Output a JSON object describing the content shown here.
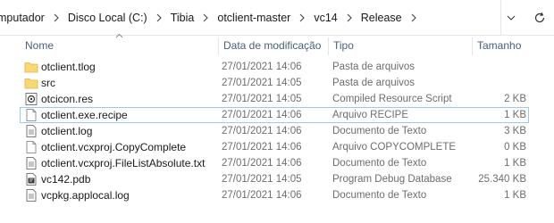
{
  "breadcrumb": [
    "mputador",
    "Disco Local (C:)",
    "Tibia",
    "otclient-master",
    "vc14",
    "Release"
  ],
  "columns": {
    "name": "Nome",
    "date": "Data de modificação",
    "type": "Tipo",
    "size": "Tamanho"
  },
  "files": [
    {
      "name": "otclient.tlog",
      "date": "27/01/2021 14:06",
      "type": "Pasta de arquivos",
      "size": "",
      "icon": "folder-icon"
    },
    {
      "name": "src",
      "date": "27/01/2021 14:05",
      "type": "Pasta de arquivos",
      "size": "",
      "icon": "folder-icon"
    },
    {
      "name": "otcicon.res",
      "date": "27/01/2021 14:05",
      "type": "Compiled Resource Script",
      "size": "2 KB",
      "icon": "resource-file-icon"
    },
    {
      "name": "otclient.exe.recipe",
      "date": "27/01/2021 14:06",
      "type": "Arquivo RECIPE",
      "size": "1 KB",
      "icon": "file-icon"
    },
    {
      "name": "otclient.log",
      "date": "27/01/2021 14:06",
      "type": "Documento de Texto",
      "size": "3 KB",
      "icon": "text-file-icon"
    },
    {
      "name": "otclient.vcxproj.CopyComplete",
      "date": "27/01/2021 14:06",
      "type": "Arquivo COPYCOMPLETE",
      "size": "0 KB",
      "icon": "file-icon"
    },
    {
      "name": "otclient.vcxproj.FileListAbsolute.txt",
      "date": "27/01/2021 14:06",
      "type": "Documento de Texto",
      "size": "1 KB",
      "icon": "text-file-icon"
    },
    {
      "name": "vc142.pdb",
      "date": "27/01/2021 14:05",
      "type": "Program Debug Database",
      "size": "25.340 KB",
      "icon": "pdb-file-icon"
    },
    {
      "name": "vcpkg.applocal.log",
      "date": "27/01/2021 14:06",
      "type": "Documento de Texto",
      "size": "1 KB",
      "icon": "text-file-icon"
    }
  ],
  "colors": {
    "folder": "#f8d775",
    "header_text": "#4c607a",
    "focus_border": "#99c9ef"
  }
}
